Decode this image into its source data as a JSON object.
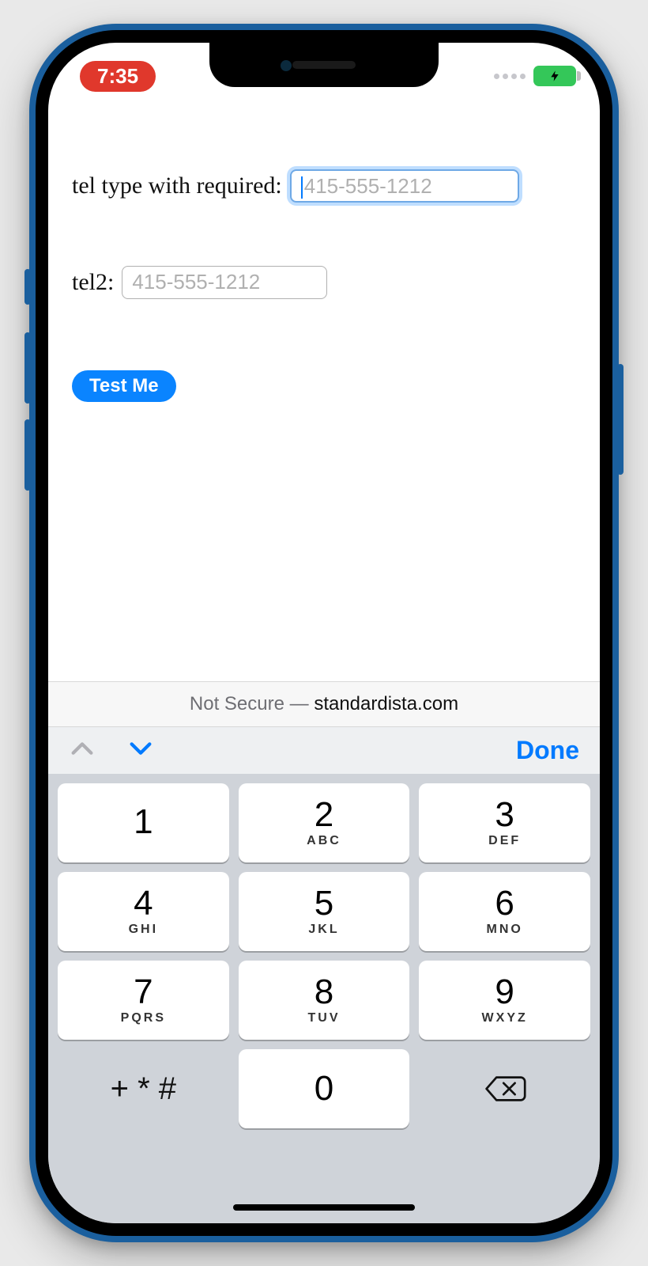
{
  "status": {
    "time": "7:35"
  },
  "form": {
    "label1": "tel type with required: ",
    "placeholder1": "415-555-1212",
    "label2": "tel2: ",
    "placeholder2": "415-555-1212",
    "button": "Test Me"
  },
  "url_bar": {
    "prefix": "Not Secure — ",
    "host": "standardista.com"
  },
  "accessory": {
    "done": "Done"
  },
  "keypad": {
    "keys": [
      {
        "num": "1",
        "sub": ""
      },
      {
        "num": "2",
        "sub": "ABC"
      },
      {
        "num": "3",
        "sub": "DEF"
      },
      {
        "num": "4",
        "sub": "GHI"
      },
      {
        "num": "5",
        "sub": "JKL"
      },
      {
        "num": "6",
        "sub": "MNO"
      },
      {
        "num": "7",
        "sub": "PQRS"
      },
      {
        "num": "8",
        "sub": "TUV"
      },
      {
        "num": "9",
        "sub": "WXYZ"
      }
    ],
    "symbols": "+ * #",
    "zero": "0"
  }
}
